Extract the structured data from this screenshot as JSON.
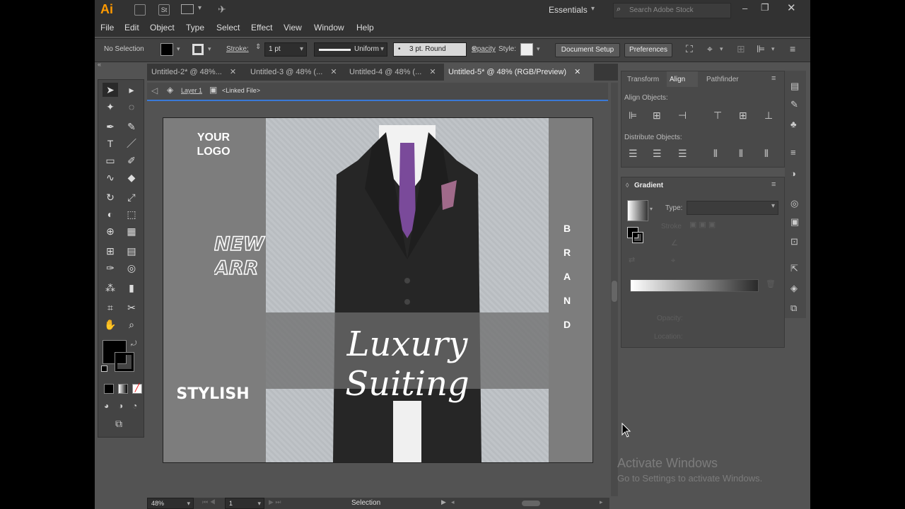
{
  "app": {
    "logo": "Ai",
    "stock_icon": "St",
    "workspace": "Essentials",
    "search_placeholder": "Search Adobe Stock"
  },
  "menu": [
    "File",
    "Edit",
    "Object",
    "Type",
    "Select",
    "Effect",
    "View",
    "Window",
    "Help"
  ],
  "control": {
    "selection": "No Selection",
    "stroke_label": "Stroke:",
    "stroke_value": "1 pt",
    "profile": "Uniform",
    "brush": "3 pt. Round",
    "opacity_label": "Opacity",
    "style_label": "Style:",
    "document_setup": "Document Setup",
    "preferences": "Preferences"
  },
  "tabs": [
    {
      "label": "Untitled-2* @ 48%..."
    },
    {
      "label": "Untitled-3 @ 48% (..."
    },
    {
      "label": "Untitled-4 @ 48% (..."
    },
    {
      "label": "Untitled-5* @ 48% (RGB/Preview)"
    }
  ],
  "breadcrumb": {
    "layer": "Layer 1",
    "item": "<Linked File>"
  },
  "artwork": {
    "logo_line1": "YOUR",
    "logo_line2": "LOGO",
    "new_line1": "NEW",
    "new_line2": "ARR",
    "brand_letters": [
      "B",
      "R",
      "A",
      "N",
      "D"
    ],
    "script_title": "Luxury Suiting",
    "stylish": "STYLISH"
  },
  "panels": {
    "tabs": [
      "Transform",
      "Align",
      "Pathfinder"
    ],
    "align_objects": "Align Objects:",
    "distribute_objects": "Distribute Objects:",
    "gradient_title": "Gradient",
    "type_label": "Type:",
    "stroke_label": "Stroke",
    "opacity_label": "Opacity:",
    "location_label": "Location:"
  },
  "status": {
    "zoom": "48%",
    "artboard": "1",
    "tool": "Selection"
  },
  "watermark": {
    "line1": "Activate Windows",
    "line2": "Go to Settings to activate Windows."
  },
  "colors": {
    "accent_blue": "#3a7ad8",
    "tie_purple": "#7a4a9a",
    "ai_orange": "#ff9a00"
  }
}
